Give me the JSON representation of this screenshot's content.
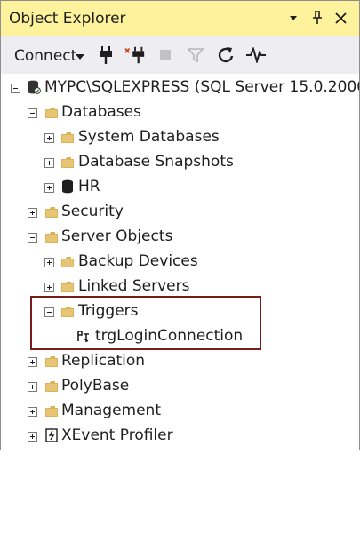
{
  "window": {
    "title": "Object Explorer",
    "buttons": [
      "dropdown",
      "pin",
      "close"
    ]
  },
  "toolbar": {
    "connect_label": "Connect",
    "tools": [
      "connect-icon",
      "disconnect-icon",
      "stop-icon",
      "filter-icon",
      "refresh-icon",
      "activity-monitor-icon"
    ]
  },
  "tree": {
    "server": "MYPC\\SQLEXPRESS (SQL Server 15.0.2000 -",
    "databases": "Databases",
    "system_databases": "System Databases",
    "database_snapshots": "Database Snapshots",
    "hr": "HR",
    "security": "Security",
    "server_objects": "Server Objects",
    "backup_devices": "Backup Devices",
    "linked_servers": "Linked Servers",
    "triggers": "Triggers",
    "trg_login": "trgLoginConnection",
    "replication": "Replication",
    "polybase": "PolyBase",
    "management": "Management",
    "xevent_profiler": "XEvent Profiler"
  },
  "colors": {
    "titlebar_bg": "#fff29d",
    "toolbar_bg": "#eeeef2",
    "folder": "#dcb359",
    "highlight_border": "#7b1c1c"
  }
}
